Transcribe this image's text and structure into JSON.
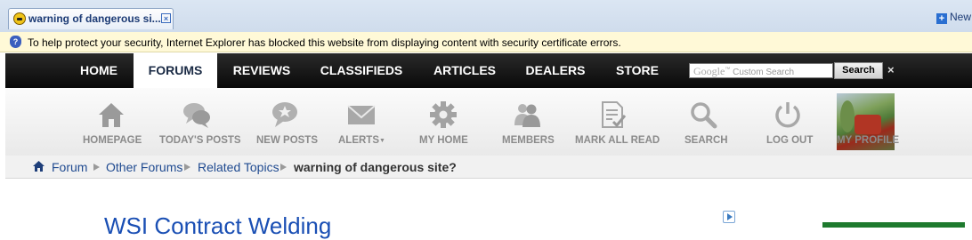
{
  "browser": {
    "tab_title": "warning of dangerous si...",
    "new_tab_label": "New",
    "new_tab_icon": "plus-icon",
    "infobar_text": "To help protect your security, Internet Explorer has blocked this website from displaying content with security certificate errors."
  },
  "topnav": {
    "items": [
      {
        "label": "HOME",
        "active": false
      },
      {
        "label": "FORUMS",
        "active": true
      },
      {
        "label": "REVIEWS",
        "active": false
      },
      {
        "label": "CLASSIFIEDS",
        "active": false
      },
      {
        "label": "ARTICLES",
        "active": false
      },
      {
        "label": "DEALERS",
        "active": false
      },
      {
        "label": "STORE",
        "active": false
      }
    ],
    "search_brand": "Google",
    "search_placeholder": "Custom Search",
    "search_button": "Search",
    "close_glyph": "×"
  },
  "iconbar": {
    "items": [
      {
        "label": "HOMEPAGE",
        "icon": "house-icon"
      },
      {
        "label": "TODAY'S POSTS",
        "icon": "chat-bubbles-icon"
      },
      {
        "label": "NEW POSTS",
        "icon": "new-posts-bubble-icon"
      },
      {
        "label": "ALERTS",
        "icon": "envelope-icon"
      },
      {
        "label": "MY HOME",
        "icon": "gear-icon"
      },
      {
        "label": "MEMBERS",
        "icon": "people-icon"
      },
      {
        "label": "MARK ALL READ",
        "icon": "document-check-icon"
      },
      {
        "label": "SEARCH",
        "icon": "magnifier-icon"
      },
      {
        "label": "LOG OUT",
        "icon": "power-icon"
      },
      {
        "label": "MY PROFILE",
        "icon": "profile-photo"
      }
    ]
  },
  "breadcrumb": {
    "items": [
      "Forum",
      "Other Forums",
      "Related Topics"
    ],
    "current": "warning of dangerous site?"
  },
  "content": {
    "ad_title": "WSI Contract Welding"
  },
  "colors": {
    "nav_bg": "#0d0d0d",
    "icon_gray": "#8b8b8b",
    "link_blue": "#1f4a90",
    "infobar_bg": "#fff9d7"
  }
}
